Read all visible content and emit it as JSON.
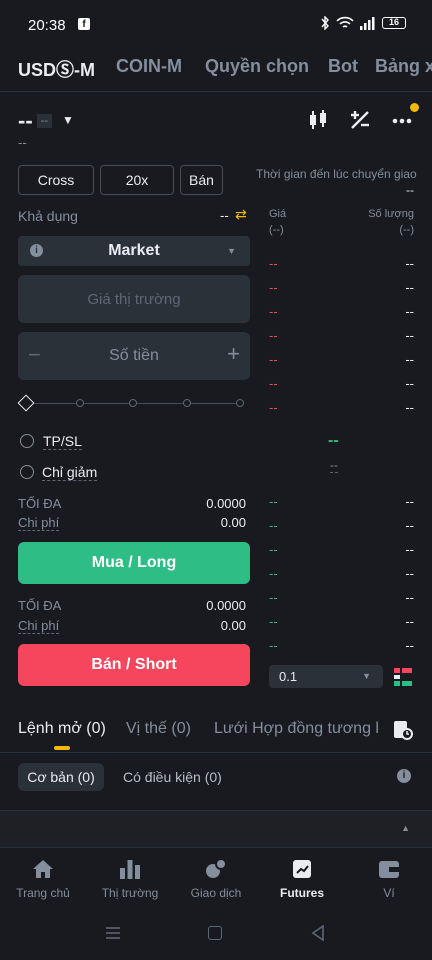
{
  "status_bar": {
    "time": "20:38",
    "battery": "16"
  },
  "top_tabs": [
    "USDⓈ-M",
    "COIN-M",
    "Quyền chọn",
    "Bot",
    "Bảng x"
  ],
  "symbol": {
    "price": "--",
    "badge": "--",
    "sub": "--"
  },
  "funding": {
    "label": "Thời gian đến lúc chuyển giao",
    "value": "--"
  },
  "order_form": {
    "margin_mode": "Cross",
    "leverage": "20x",
    "side_mode": "Bán",
    "available_label": "Khả dụng",
    "available_value": "--",
    "order_type": "Market",
    "price_placeholder": "Giá thị trường",
    "amount_placeholder": "Số tiền",
    "tpsl_label": "TP/SL",
    "reduce_only_label": "Chỉ giảm",
    "buy": {
      "max_label": "TỐI ĐA",
      "max_value": "0.0000",
      "cost_label": "Chi phí",
      "cost_value": "0.00",
      "button": "Mua / Long"
    },
    "sell": {
      "max_label": "TỐI ĐA",
      "max_value": "0.0000",
      "cost_label": "Chi phí",
      "cost_value": "0.00",
      "button": "Bán / Short"
    }
  },
  "order_book": {
    "price_header": "Giá",
    "price_unit": "(--)",
    "qty_header": "Số lượng",
    "qty_unit": "(--)",
    "asks": [
      [
        "--",
        "--"
      ],
      [
        "--",
        "--"
      ],
      [
        "--",
        "--"
      ],
      [
        "--",
        "--"
      ],
      [
        "--",
        "--"
      ],
      [
        "--",
        "--"
      ],
      [
        "--",
        "--"
      ]
    ],
    "mid_price": "--",
    "mid_sub": "--",
    "bids": [
      [
        "--",
        "--"
      ],
      [
        "--",
        "--"
      ],
      [
        "--",
        "--"
      ],
      [
        "--",
        "--"
      ],
      [
        "--",
        "--"
      ],
      [
        "--",
        "--"
      ],
      [
        "--",
        "--"
      ]
    ],
    "tick_size": "0.1"
  },
  "bottom_tabs": {
    "open_orders": "Lệnh mở (0)",
    "positions": "Vị thế (0)",
    "grid": "Lưới Hợp đồng tương l"
  },
  "sub_tabs": {
    "basic": "Cơ bản (0)",
    "conditional": "Có điều kiện (0)"
  },
  "nav": [
    "Trang chủ",
    "Thị trường",
    "Giao dịch",
    "Futures",
    "Ví"
  ],
  "colors": {
    "buy": "#2ebd85",
    "sell": "#f6465d",
    "accent": "#f0b90b",
    "bg": "#181a20"
  }
}
